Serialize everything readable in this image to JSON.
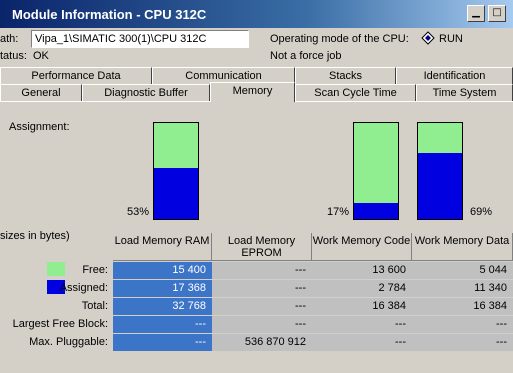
{
  "window": {
    "title": "Module Information - CPU 312C"
  },
  "info": {
    "path_label": "ath:",
    "path_value": "Vipa_1\\SIMATIC 300(1)\\CPU 312C",
    "status_label": "tatus:",
    "status_value": "OK",
    "op_mode_label": "Operating mode of the  CPU:",
    "op_mode_value": "RUN",
    "force_text": "Not a force job"
  },
  "tabs_row1": [
    "Performance Data",
    "Communication",
    "Stacks",
    "Identification"
  ],
  "tabs_row2": [
    "General",
    "Diagnostic Buffer",
    "Memory",
    "Scan Cycle Time",
    "Time System"
  ],
  "active_tab": "Memory",
  "memory": {
    "assignment_label": "Assignment:",
    "sizes_label": "sizes in bytes)",
    "bars": [
      {
        "assigned_fraction": 0.53,
        "percent": "53%"
      },
      {
        "assigned_fraction": 0.17,
        "percent": "17%"
      },
      {
        "assigned_fraction": 0.69,
        "percent": "69%"
      }
    ],
    "colors": {
      "free": "#90ee90",
      "assigned": "#0000e0"
    },
    "columns": [
      "Load Memory RAM",
      "Load Memory EPROM",
      "Work Memory Code",
      "Work Memory Data"
    ],
    "rows": [
      {
        "label": "Free:",
        "values": [
          "15 400",
          "---",
          "13 600",
          "5 044"
        ]
      },
      {
        "label": "Assigned:",
        "values": [
          "17 368",
          "---",
          "2 784",
          "11 340"
        ]
      },
      {
        "label": "Total:",
        "values": [
          "32 768",
          "---",
          "16 384",
          "16 384"
        ]
      },
      {
        "label": "Largest Free Block:",
        "values": [
          "---",
          "---",
          "---",
          "---"
        ]
      },
      {
        "label": "Max. Pluggable:",
        "values": [
          "---",
          "536 870 912",
          "---",
          "---"
        ]
      }
    ]
  }
}
